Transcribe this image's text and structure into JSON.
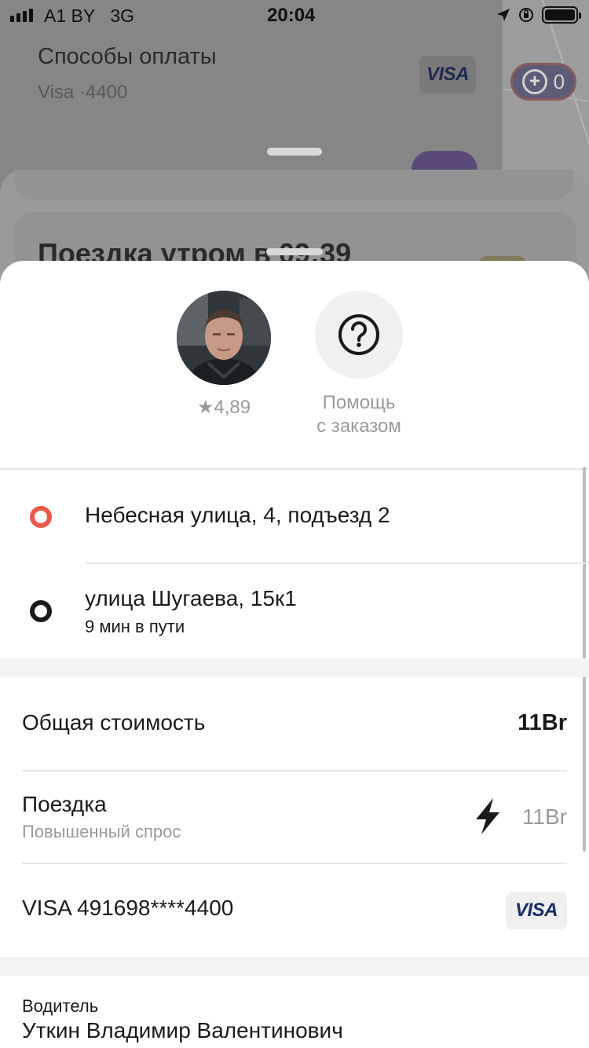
{
  "status_bar": {
    "carrier": "A1 BY",
    "network": "3G",
    "time": "20:04"
  },
  "background": {
    "payment_methods_title": "Способы оплаты",
    "payment_methods_card": "Visa ·4400",
    "visa_logo": "VISA",
    "plus_count": "0",
    "trip_title": "Поездка утром в 09:39"
  },
  "driver": {
    "rating": "★4,89",
    "caption": "Водитель",
    "name": "Уткин Владимир Валентинович"
  },
  "help": {
    "label_line1": "Помощь",
    "label_line2": "с заказом",
    "icon": "question-circle-icon"
  },
  "route": {
    "from": "Небесная улица, 4, подъезд 2",
    "to": "улица Шугаева, 15к1",
    "eta": "9 мин в пути",
    "colors": {
      "from": "#ea5a4b",
      "to": "#1a1a1a"
    }
  },
  "cost": {
    "total_label": "Общая стоимость",
    "total_value": "11Br",
    "ride_label": "Поездка",
    "ride_sub": "Повышенный спрос",
    "ride_value": "11Br",
    "surge_icon": "bolt-icon",
    "card_label": "VISA 491698****4400",
    "card_logo": "VISA"
  }
}
